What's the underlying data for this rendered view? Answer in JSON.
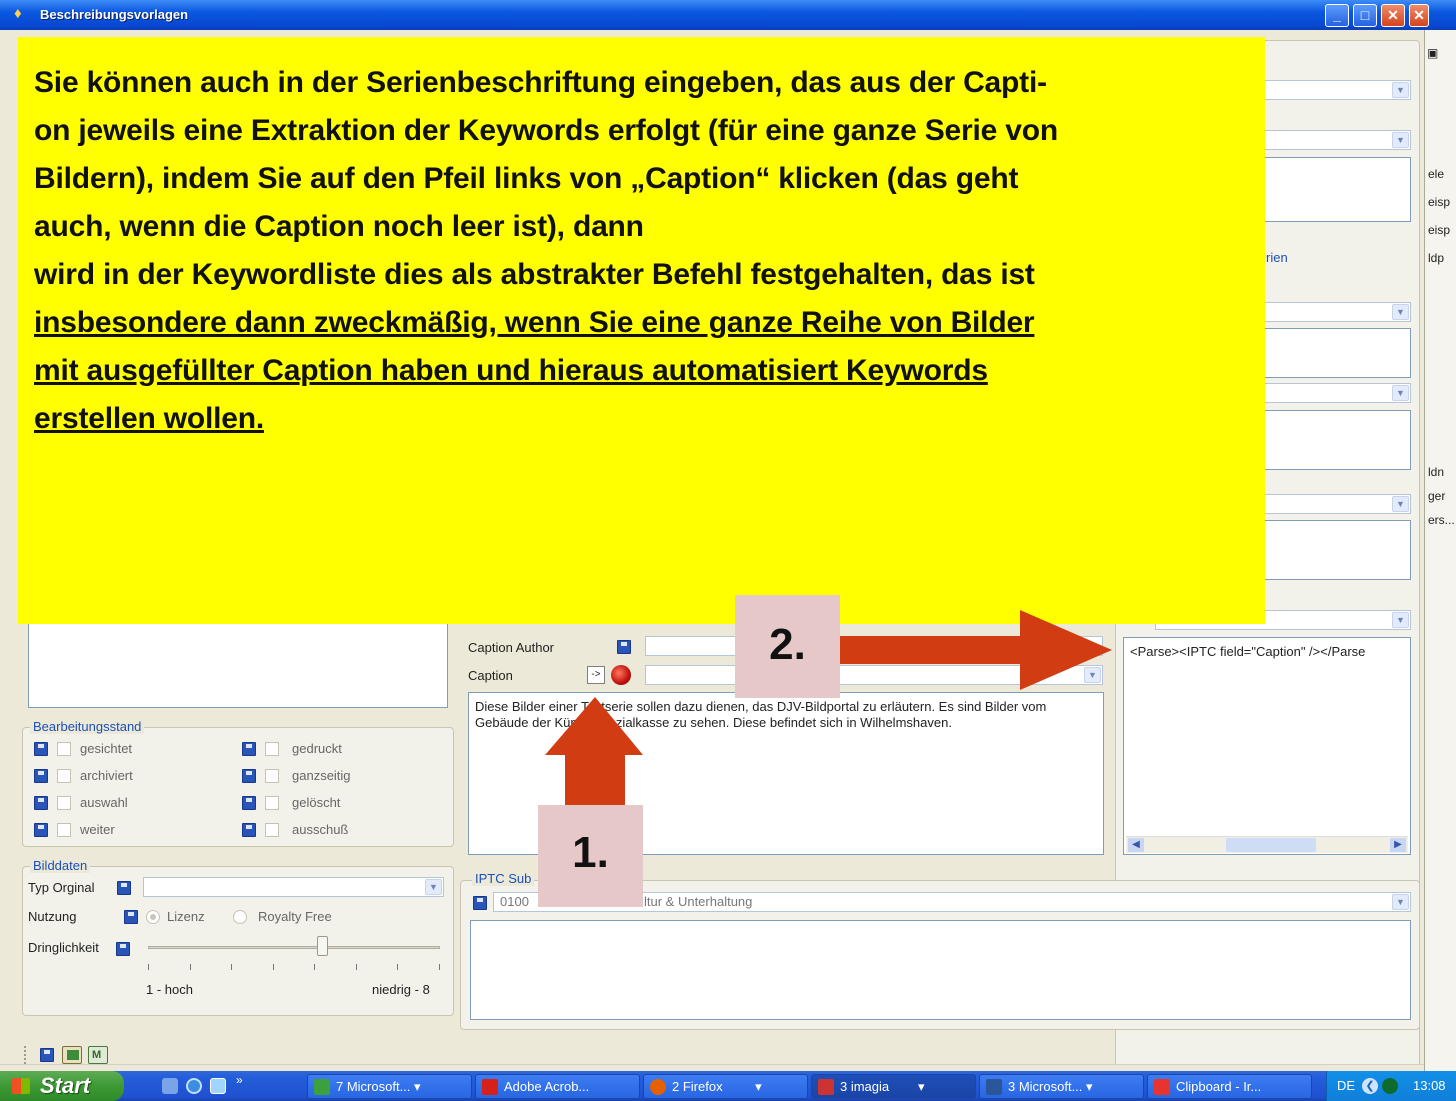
{
  "window": {
    "title": "Beschreibungsvorlagen"
  },
  "note": {
    "lines": [
      "Sie können auch in der Serienbeschriftung eingeben, das aus der Capti-",
      "on jeweils eine Extraktion der Keywords erfolgt (für eine ganze Serie von",
      "Bildern), indem Sie auf den Pfeil links von „Caption“ klicken (das geht",
      "auch, wenn die Caption noch leer ist), dann",
      "wird in der Keywordliste dies als abstrakter Befehl festgehalten, das ist"
    ],
    "underlined": [
      "insbesondere dann zweckmäßig, wenn Sie eine ganze Reihe von Bilder",
      "mit ausgefüllter Caption haben und hieraus automatisiert Keywords",
      "erstellen wollen."
    ]
  },
  "annotations": {
    "step1": "1.",
    "step2": "2."
  },
  "right_panel": {
    "group_fragment": "rien",
    "parse_text": "<Parse><IPTC field=\"Caption\" /></Parse"
  },
  "edge_panel": {
    "items": [
      "ele",
      "eisp",
      "eisp",
      "ldp",
      "ldn",
      "ger",
      "ers..."
    ]
  },
  "caption_area": {
    "caption_author_label": "Caption Author",
    "caption_label": "Caption",
    "arrow_button": "->",
    "text": "Diese Bilder einer Testserie sollen dazu dienen, das DJV-Bildportal zu erläutern. Es sind Bilder vom Gebäude der Künstlersozialkasse zu sehen. Diese befindet sich in Wilhelmshaven."
  },
  "bearbeitungsstand": {
    "title": "Bearbeitungsstand",
    "left": [
      "gesichtet",
      "archiviert",
      "auswahl",
      "weiter"
    ],
    "right": [
      "gedruckt",
      "ganzseitig",
      "gelöscht",
      "ausschuß"
    ]
  },
  "bilddaten": {
    "title": "Bilddaten",
    "typ_label": "Typ Orginal",
    "nutzung_label": "Nutzung",
    "radio_lizenz": "Lizenz",
    "radio_royalty": "Royalty Free",
    "dringlichkeit_label": "Dringlichkeit",
    "slider_min": "1 - hoch",
    "slider_max": "niedrig - 8",
    "slider_level": 0.6
  },
  "iptc": {
    "title": "IPTC Sub",
    "code": "0100",
    "value": "ltur & Unterhaltung"
  },
  "taskbar": {
    "start": "Start",
    "tasks": [
      "7 Microsoft...",
      "Adobe Acrob...",
      "2 Firefox",
      "3 imagia",
      "3 Microsoft...",
      "Clipboard - Ir..."
    ],
    "lang": "DE",
    "time": "13:08"
  },
  "colors": {
    "note_bg": "#ffff00",
    "arrow": "#d23c12",
    "tag_bg": "#e6c8c9",
    "title_bar": "#0b58e0"
  }
}
